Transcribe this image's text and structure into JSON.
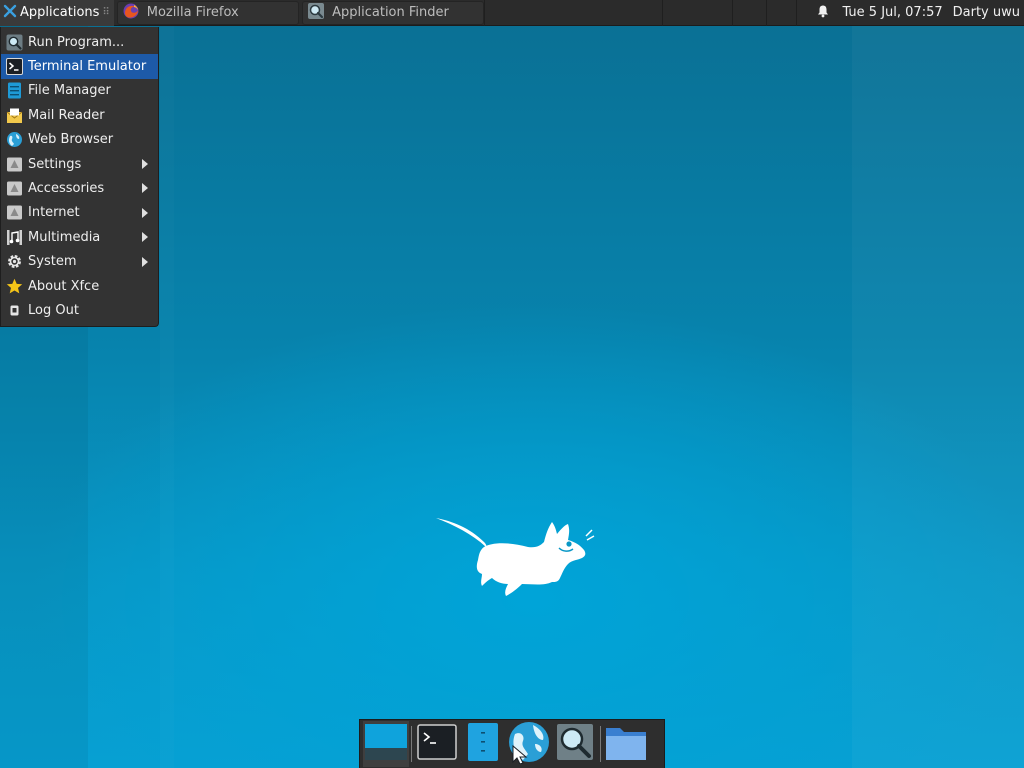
{
  "top_panel": {
    "applications_label": "Applications",
    "tasks": [
      {
        "label": "Mozilla Firefox",
        "icon": "firefox-icon"
      },
      {
        "label": "Application Finder",
        "icon": "app-finder-icon"
      }
    ],
    "notification_icon": "bell-icon",
    "clock": "Tue  5 Jul, 07:57",
    "user": "Darty uwu"
  },
  "menu": {
    "items": [
      {
        "label": "Run Program...",
        "icon": "run-program-icon",
        "submenu": false,
        "active": false
      },
      {
        "label": "Terminal Emulator",
        "icon": "terminal-icon",
        "submenu": false,
        "active": true
      },
      {
        "label": "File Manager",
        "icon": "file-manager-icon",
        "submenu": false,
        "active": false
      },
      {
        "label": "Mail Reader",
        "icon": "mail-icon",
        "submenu": false,
        "active": false
      },
      {
        "label": "Web Browser",
        "icon": "web-browser-icon",
        "submenu": false,
        "active": false
      },
      {
        "label": "Settings",
        "icon": "settings-icon",
        "submenu": true,
        "active": false
      },
      {
        "label": "Accessories",
        "icon": "accessories-icon",
        "submenu": true,
        "active": false
      },
      {
        "label": "Internet",
        "icon": "internet-icon",
        "submenu": true,
        "active": false
      },
      {
        "label": "Multimedia",
        "icon": "multimedia-icon",
        "submenu": true,
        "active": false
      },
      {
        "label": "System",
        "icon": "system-gear-icon",
        "submenu": true,
        "active": false
      },
      {
        "label": "About Xfce",
        "icon": "star-icon",
        "submenu": false,
        "active": false
      },
      {
        "label": "Log Out",
        "icon": "logout-icon",
        "submenu": false,
        "active": false
      }
    ]
  },
  "dock": {
    "items": [
      "show-desktop-icon",
      "terminal-icon",
      "file-manager-icon",
      "web-browser-icon",
      "app-finder-icon",
      "folder-icon"
    ]
  },
  "colors": {
    "accent": "#1d5aa8",
    "panel": "#2b2b2b",
    "desktop": "#0897c6"
  }
}
